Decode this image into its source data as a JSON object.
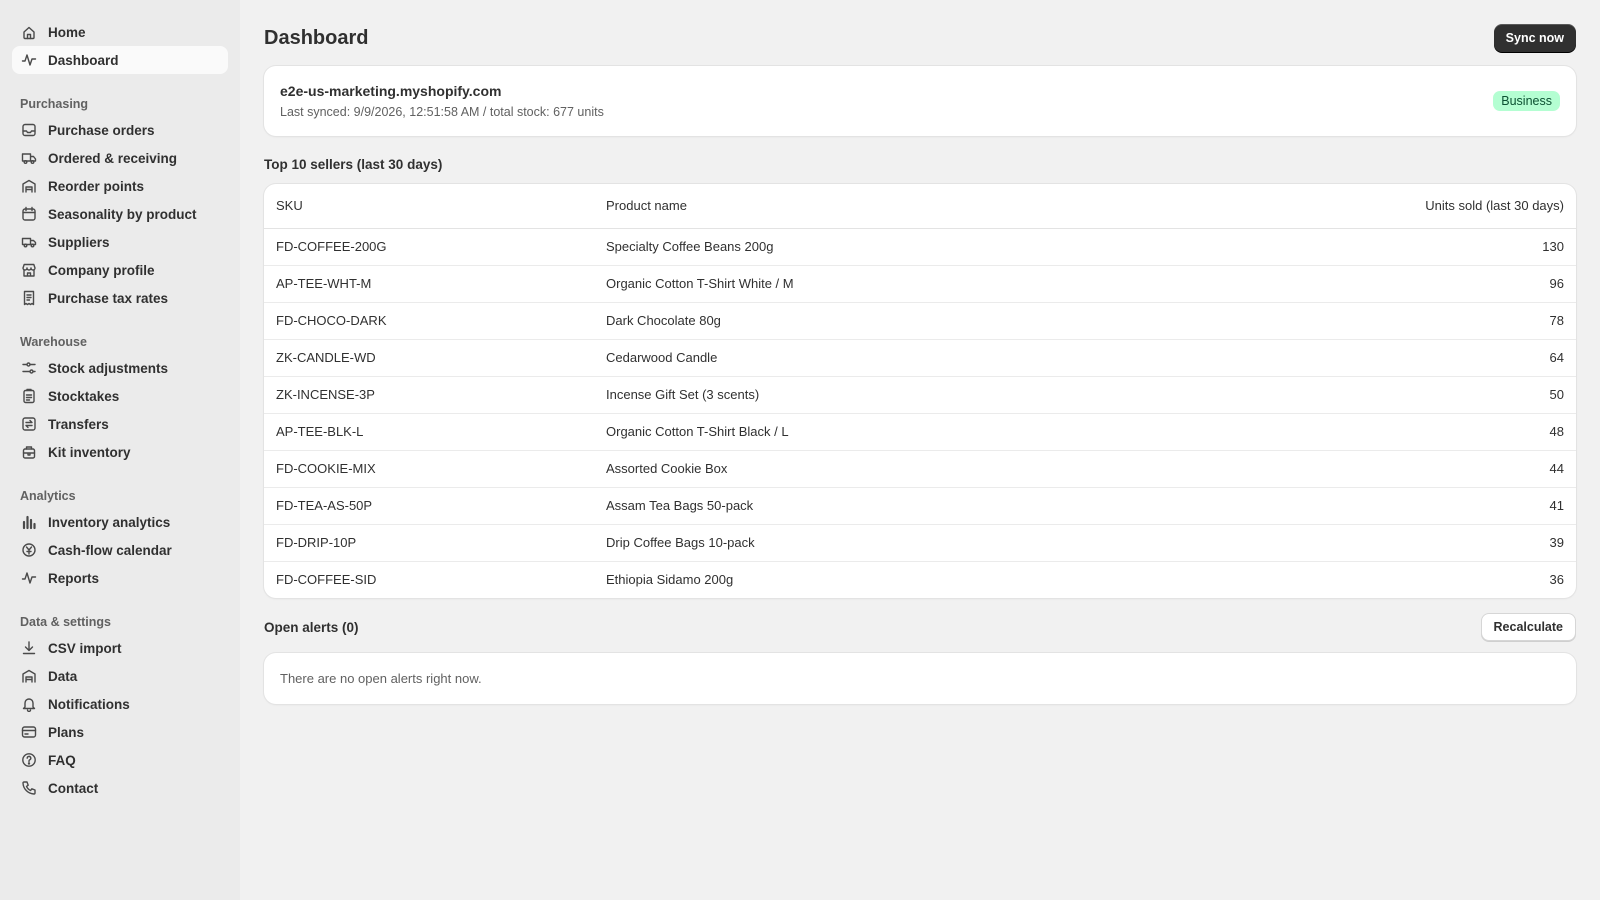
{
  "sidebar": {
    "top": [
      {
        "label": "Home",
        "icon": "home-icon"
      },
      {
        "label": "Dashboard",
        "icon": "activity-icon",
        "active": true
      }
    ],
    "sections": [
      {
        "title": "Purchasing",
        "items": [
          {
            "label": "Purchase orders",
            "icon": "inbox-icon"
          },
          {
            "label": "Ordered & receiving",
            "icon": "truck-icon"
          },
          {
            "label": "Reorder points",
            "icon": "warehouse-icon"
          },
          {
            "label": "Seasonality by product",
            "icon": "calendar-icon"
          },
          {
            "label": "Suppliers",
            "icon": "delivery-icon"
          },
          {
            "label": "Company profile",
            "icon": "store-icon"
          },
          {
            "label": "Purchase tax rates",
            "icon": "receipt-icon"
          }
        ]
      },
      {
        "title": "Warehouse",
        "items": [
          {
            "label": "Stock adjustments",
            "icon": "sliders-icon"
          },
          {
            "label": "Stocktakes",
            "icon": "clipboard-icon"
          },
          {
            "label": "Transfers",
            "icon": "transfer-icon"
          },
          {
            "label": "Kit inventory",
            "icon": "kit-icon"
          }
        ]
      },
      {
        "title": "Analytics",
        "items": [
          {
            "label": "Inventory analytics",
            "icon": "bar-chart-icon"
          },
          {
            "label": "Cash-flow calendar",
            "icon": "currency-icon"
          },
          {
            "label": "Reports",
            "icon": "pulse-icon"
          }
        ]
      },
      {
        "title": "Data & settings",
        "items": [
          {
            "label": "CSV import",
            "icon": "download-icon"
          },
          {
            "label": "Data",
            "icon": "database-icon"
          },
          {
            "label": "Notifications",
            "icon": "bell-icon"
          },
          {
            "label": "Plans",
            "icon": "credit-card-icon"
          },
          {
            "label": "FAQ",
            "icon": "question-icon"
          },
          {
            "label": "Contact",
            "icon": "phone-icon"
          }
        ]
      }
    ]
  },
  "header": {
    "title": "Dashboard",
    "sync_label": "Sync now"
  },
  "store": {
    "domain": "e2e-us-marketing.myshopify.com",
    "meta": "Last synced: 9/9/2026, 12:51:58 AM / total stock: 677 units",
    "plan_badge": "Business",
    "badge_color": "#b4fed2"
  },
  "sellers": {
    "title": "Top 10 sellers (last 30 days)",
    "columns": [
      "SKU",
      "Product name",
      "Units sold (last 30 days)"
    ],
    "rows": [
      {
        "sku": "FD-COFFEE-200G",
        "name": "Specialty Coffee Beans 200g",
        "units": "130"
      },
      {
        "sku": "AP-TEE-WHT-M",
        "name": "Organic Cotton T-Shirt White / M",
        "units": "96"
      },
      {
        "sku": "FD-CHOCO-DARK",
        "name": "Dark Chocolate 80g",
        "units": "78"
      },
      {
        "sku": "ZK-CANDLE-WD",
        "name": "Cedarwood Candle",
        "units": "64"
      },
      {
        "sku": "ZK-INCENSE-3P",
        "name": "Incense Gift Set (3 scents)",
        "units": "50"
      },
      {
        "sku": "AP-TEE-BLK-L",
        "name": "Organic Cotton T-Shirt Black / L",
        "units": "48"
      },
      {
        "sku": "FD-COOKIE-MIX",
        "name": "Assorted Cookie Box",
        "units": "44"
      },
      {
        "sku": "FD-TEA-AS-50P",
        "name": "Assam Tea Bags 50-pack",
        "units": "41"
      },
      {
        "sku": "FD-DRIP-10P",
        "name": "Drip Coffee Bags 10-pack",
        "units": "39"
      },
      {
        "sku": "FD-COFFEE-SID",
        "name": "Ethiopia Sidamo 200g",
        "units": "36"
      }
    ]
  },
  "alerts": {
    "title": "Open alerts (0)",
    "recalc_label": "Recalculate",
    "empty_text": "There are no open alerts right now."
  }
}
